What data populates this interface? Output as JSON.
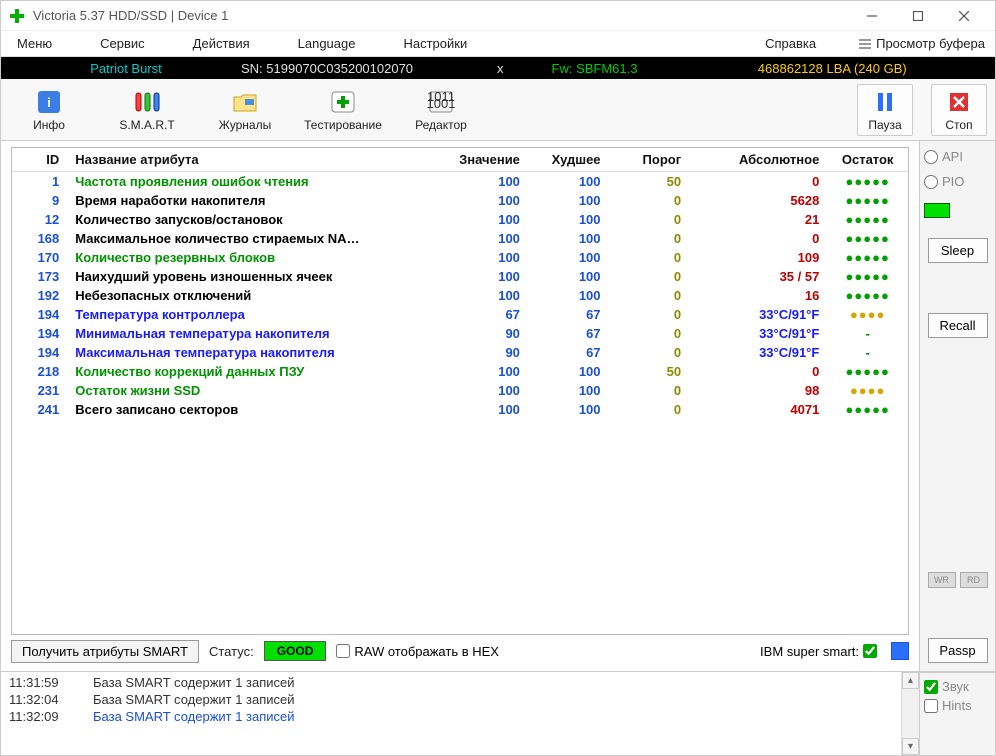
{
  "window": {
    "title": "Victoria 5.37 HDD/SSD | Device 1"
  },
  "menu": {
    "items": [
      "Меню",
      "Сервис",
      "Действия",
      "Language",
      "Настройки",
      "Справка"
    ],
    "buffer": "Просмотр буфера"
  },
  "infobar": {
    "model": "Patriot Burst",
    "sn": "SN: 5199070C035200102070",
    "fw": "Fw: SBFM61.3",
    "lba": "468862128 LBA (240 GB)",
    "close": "x"
  },
  "toolbar": {
    "info": "Инфо",
    "smart": "S.M.A.R.T",
    "journals": "Журналы",
    "test": "Тестирование",
    "editor": "Редактор",
    "pause": "Пауза",
    "stop": "Стоп"
  },
  "table": {
    "headers": {
      "id": "ID",
      "name": "Название атрибута",
      "val": "Значение",
      "worst": "Худшее",
      "thr": "Порог",
      "abs": "Абсолютное",
      "rest": "Остаток"
    },
    "rows": [
      {
        "id": "1",
        "name": "Частота проявления ошибок чтения",
        "cls": "green",
        "val": "100",
        "worst": "100",
        "thr": "50",
        "abs": "0",
        "absCls": "",
        "dots": "green"
      },
      {
        "id": "9",
        "name": "Время наработки накопителя",
        "cls": "navy",
        "val": "100",
        "worst": "100",
        "thr": "0",
        "abs": "5628",
        "absCls": "",
        "dots": "green"
      },
      {
        "id": "12",
        "name": "Количество запусков/остановок",
        "cls": "navy",
        "val": "100",
        "worst": "100",
        "thr": "0",
        "abs": "21",
        "absCls": "",
        "dots": "green"
      },
      {
        "id": "168",
        "name": "Максимальное количество стираемых NA…",
        "cls": "navy",
        "val": "100",
        "worst": "100",
        "thr": "0",
        "abs": "0",
        "absCls": "",
        "dots": "green"
      },
      {
        "id": "170",
        "name": "Количество резервных блоков",
        "cls": "green",
        "val": "100",
        "worst": "100",
        "thr": "0",
        "abs": "109",
        "absCls": "",
        "dots": "green"
      },
      {
        "id": "173",
        "name": "Наихудший уровень изношенных ячеек",
        "cls": "navy",
        "val": "100",
        "worst": "100",
        "thr": "0",
        "abs": "35 / 57",
        "absCls": "",
        "dots": "green"
      },
      {
        "id": "192",
        "name": "Небезопасных отключений",
        "cls": "navy",
        "val": "100",
        "worst": "100",
        "thr": "0",
        "abs": "16",
        "absCls": "",
        "dots": "green"
      },
      {
        "id": "194",
        "name": "Температура контроллера",
        "cls": "blue",
        "val": "67",
        "worst": "67",
        "thr": "0",
        "abs": "33°C/91°F",
        "absCls": "blue",
        "dots": "yellow"
      },
      {
        "id": "194",
        "name": "Минимальная температура накопителя",
        "cls": "blue",
        "val": "90",
        "worst": "67",
        "thr": "0",
        "abs": "33°C/91°F",
        "absCls": "blue",
        "dots": "dash"
      },
      {
        "id": "194",
        "name": "Максимальная температура накопителя",
        "cls": "blue",
        "val": "90",
        "worst": "67",
        "thr": "0",
        "abs": "33°C/91°F",
        "absCls": "blue",
        "dots": "dash"
      },
      {
        "id": "218",
        "name": "Количество коррекций данных ПЗУ",
        "cls": "green",
        "val": "100",
        "worst": "100",
        "thr": "50",
        "abs": "0",
        "absCls": "",
        "dots": "green"
      },
      {
        "id": "231",
        "name": "Остаток жизни SSD",
        "cls": "green",
        "val": "100",
        "worst": "100",
        "thr": "0",
        "abs": "98",
        "absCls": "",
        "dots": "yellow"
      },
      {
        "id": "241",
        "name": "Всего записано секторов",
        "cls": "navy",
        "val": "100",
        "worst": "100",
        "thr": "0",
        "abs": "4071",
        "absCls": "",
        "dots": "green"
      }
    ]
  },
  "statusbar": {
    "getAttrs": "Получить атрибуты SMART",
    "statusLabel": "Статус:",
    "good": "GOOD",
    "rawHex": "RAW отображать в HEX",
    "ibm": "IBM super smart:"
  },
  "log": [
    {
      "ts": "11:31:59",
      "msg": "База SMART содержит 1 записей",
      "blue": false
    },
    {
      "ts": "11:32:04",
      "msg": "База SMART содержит 1 записей",
      "blue": false
    },
    {
      "ts": "11:32:09",
      "msg": "База SMART содержит 1 записей",
      "blue": true
    }
  ],
  "sidebar": {
    "api": "API",
    "pio": "PIO",
    "sleep": "Sleep",
    "recall": "Recall",
    "wr": "WR",
    "rd": "RD",
    "passp": "Passp",
    "sound": "Звук",
    "hints": "Hints"
  }
}
